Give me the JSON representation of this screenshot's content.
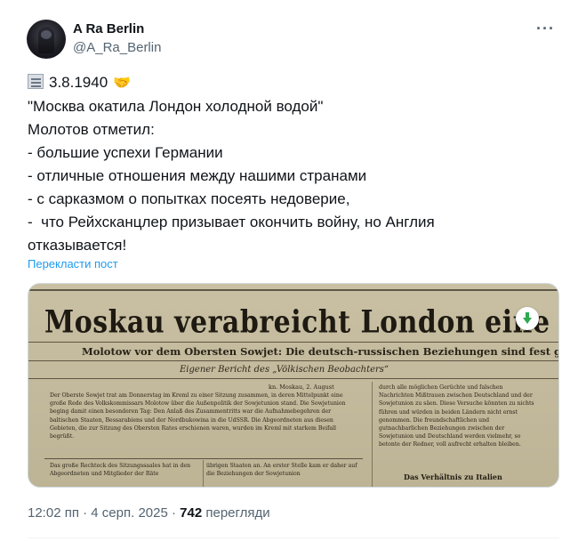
{
  "author": {
    "name": "A Ra Berlin",
    "handle": "@A_Ra_Berlin"
  },
  "icons": {
    "more": "more-icon",
    "newspaper": "newspaper-emoji",
    "handshake": "handshake-emoji",
    "download": "download-icon"
  },
  "post": {
    "lines": [
      "3.8.1940",
      "\"Москва окатила Лондон холодной водой\"",
      "Молотов отметил:",
      "- большие успехи Германии",
      "- отличные отношения между нашими странами",
      "- с сарказмом о попытках посеять недоверие,",
      "-  что Рейхсканцлер призывает окончить войну, но Англия",
      "отказывается!"
    ],
    "translate_label": "Перекласти пост"
  },
  "media": {
    "headline": "Moskau verabreicht London eine kalte Dusche",
    "subhead": "Molotow vor dem Obersten Sowjet: Die deutsch-russischen Beziehungen sind fest gegründet",
    "byline": "Eigener Bericht des „Völkischen Beobachters“",
    "location": "kn. Moskau, 2. August",
    "column_a": "Der Oberste Sowjet trat am Donnerstag im Kreml zu einer Sitzung zusammen, in deren Mittelpunkt eine große Rede des Volkskommissars Molotow über die Außenpolitik der Sowjetunion stand. Die Sowjetunion beging damit einen besonderen Tag: Den Anlaß des Zusammentritts war die Aufnahmebegehren der baltischen Staaten, Bessarabiens und der Nordbukowina in die UdSSR. Die Abgeordneten aus diesen Gebieten, die zur Sitzung des Obersten Rates erschienen waren, wurden im Kreml mit starkem Beifall begrüßt.",
    "column_b": "Das große Rechteck des Sitzungssaales hat in den Abgeordneten und Mitglieder der Räte",
    "column_c": "übrigen Staaten an. An erster Stelle kam er daher auf die Beziehungen der Sowjetunion",
    "column_d": "durch alle möglichen Gerüchte und falschen Nachrichten Mißtrauen zwischen Deutschland und der Sowjetunion zu säen. Diese Versuche könnten zu nichts führen und würden in beiden Ländern nicht ernst genommen. Die freundschaftlichen und gutnachbarlichen Beziehungen zwischen der Sowjetunion und Deutschland werden vielmehr, so betonte der Redner, voll aufrecht erhalten bleiben.",
    "column_head": "Das Verhältnis zu Italien"
  },
  "meta": {
    "time": "12:02 пп",
    "separator": " · ",
    "date": "4 серп. 2025",
    "views_count": "742",
    "views_label": "перегляди"
  },
  "colors": {
    "text": "#0f1419",
    "secondary": "#536471",
    "link": "#1d9bf0",
    "download_arrow": "#2eaa4f",
    "paper": "#c6bd9f"
  }
}
